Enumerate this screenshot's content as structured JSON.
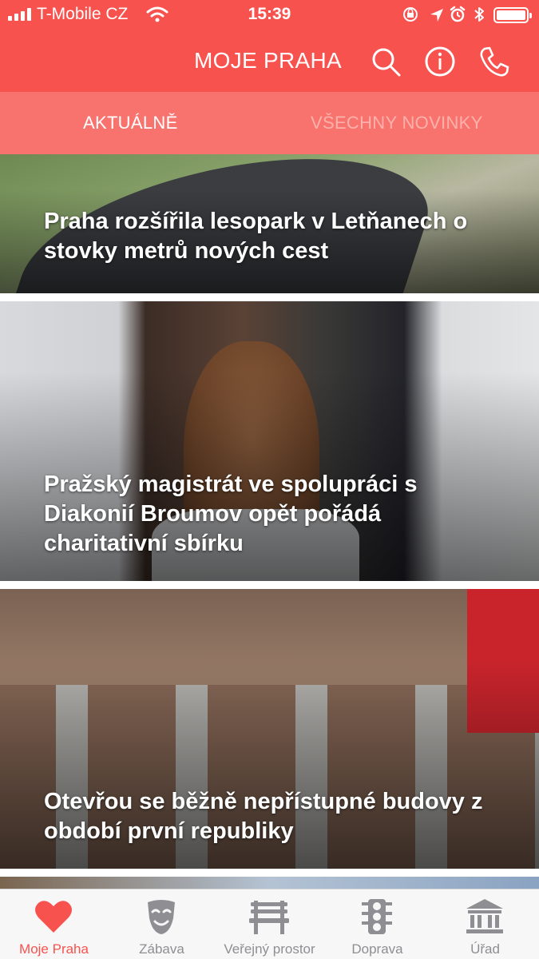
{
  "status_bar": {
    "carrier": "T-Mobile CZ",
    "time": "15:39",
    "icons": [
      "signal-icon",
      "wifi-icon",
      "orientation-lock-icon",
      "location-icon",
      "alarm-icon",
      "bluetooth-icon",
      "battery-icon"
    ]
  },
  "header": {
    "title": "MOJE PRAHA",
    "icons": [
      "search-icon",
      "info-icon",
      "phone-icon"
    ]
  },
  "tabs": [
    {
      "label": "AKTUÁLNĚ",
      "active": true
    },
    {
      "label": "VŠECHNY NOVINKY",
      "active": false
    }
  ],
  "feed": [
    {
      "headline": "Praha rozšířila lesopark v Letňanech o stovky metrů nových cest"
    },
    {
      "headline": "Pražský magistrát ve spolupráci s Diakonií Broumov opět pořádá charitativní sbírku"
    },
    {
      "headline": "Otevřou se běžně nepřístupné budovy z období první republiky"
    }
  ],
  "tabbar": {
    "items": [
      {
        "label": "Moje Praha",
        "icon": "heart-icon",
        "active": true
      },
      {
        "label": "Zábava",
        "icon": "theater-mask-icon",
        "active": false
      },
      {
        "label": "Veřejný prostor",
        "icon": "bench-icon",
        "active": false
      },
      {
        "label": "Doprava",
        "icon": "traffic-light-icon",
        "active": false
      },
      {
        "label": "Úřad",
        "icon": "government-building-icon",
        "active": false
      }
    ]
  },
  "colors": {
    "brand_red": "#f8524f",
    "tab_strip": "#f9736e",
    "inactive_tab_text": "#fdb1ab",
    "tabbar_inactive": "#8e8e93"
  }
}
